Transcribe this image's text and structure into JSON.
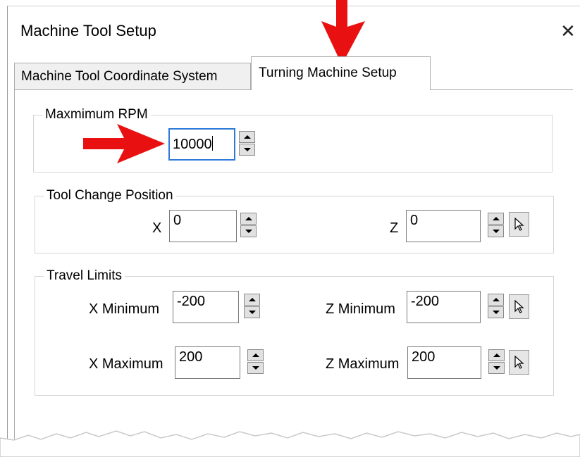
{
  "window": {
    "title": "Machine Tool Setup",
    "close_glyph": "✕"
  },
  "tabs": [
    {
      "label": "Machine Tool Coordinate System",
      "active": false
    },
    {
      "label": "Turning Machine Setup",
      "active": true
    }
  ],
  "max_rpm": {
    "label": "Maxmimum RPM",
    "value": "10000"
  },
  "tool_change": {
    "label": "Tool Change Position",
    "x_label": "X",
    "x_value": "0",
    "z_label": "Z",
    "z_value": "0"
  },
  "travel_limits": {
    "label": "Travel Limits",
    "x_min_label": "X Minimum",
    "x_min_value": "-200",
    "z_min_label": "Z Minimum",
    "z_min_value": "-200",
    "x_max_label": "X Maximum",
    "x_max_value": "200",
    "z_max_label": "Z Maximum",
    "z_max_value": "200"
  },
  "colors": {
    "accent_focus": "#2f7ad8",
    "annotation_arrow": "#e81010"
  }
}
